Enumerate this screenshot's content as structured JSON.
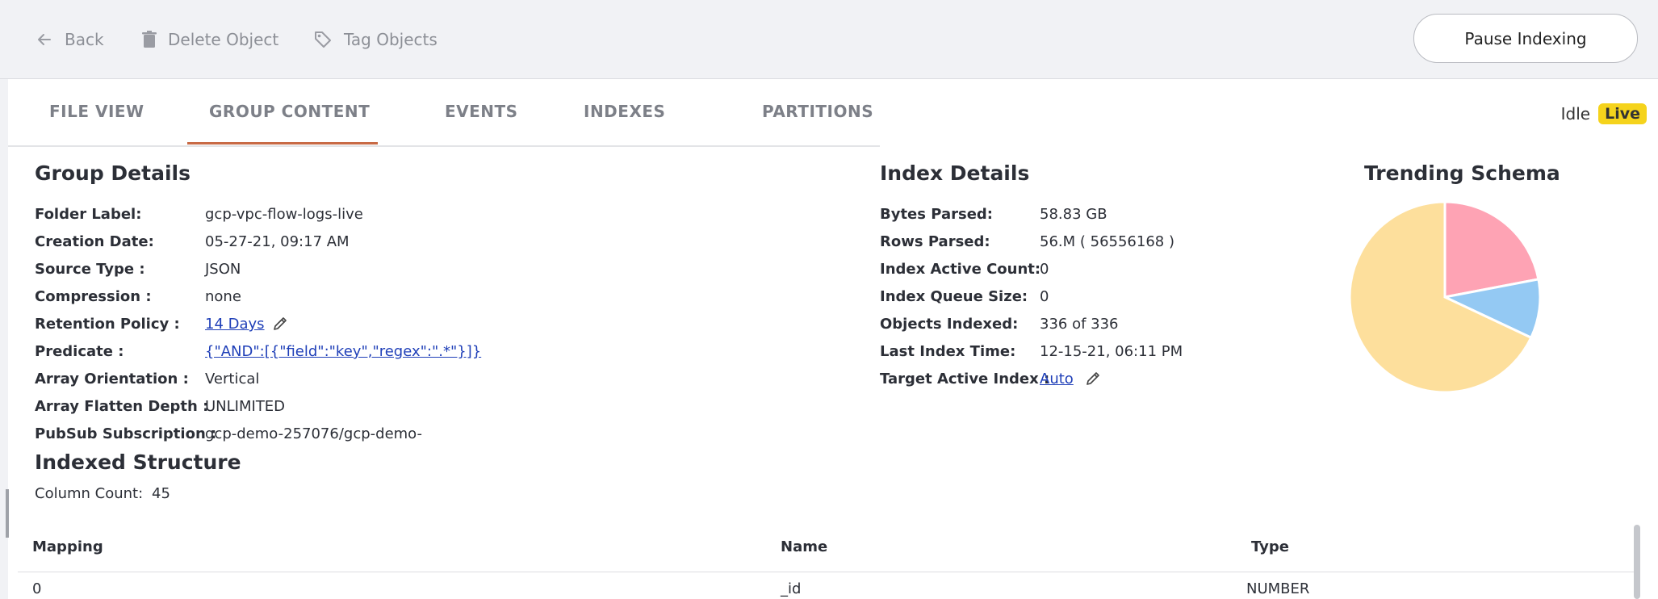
{
  "toolbar": {
    "back_label": "Back",
    "delete_label": "Delete Object",
    "tag_label": "Tag Objects",
    "pause_label": "Pause Indexing"
  },
  "tabs": [
    {
      "label": "FILE VIEW"
    },
    {
      "label": "GROUP CONTENT",
      "active": true
    },
    {
      "label": "EVENTS"
    },
    {
      "label": "INDEXES"
    },
    {
      "label": "PARTITIONS"
    }
  ],
  "status": {
    "state": "Idle",
    "badge": "Live",
    "badge_color": "#f5d31c"
  },
  "group_details": {
    "title": "Group Details",
    "rows": [
      {
        "label": "Folder Label:",
        "value": "gcp-vpc-flow-logs-live"
      },
      {
        "label": "Creation Date:",
        "value": "05-27-21, 09:17 AM"
      },
      {
        "label": "Source Type :",
        "value": "JSON"
      },
      {
        "label": "Compression :",
        "value": "none"
      },
      {
        "label": "Retention Policy :",
        "value": "14 Days"
      },
      {
        "label": "Predicate :",
        "value": "{\"AND\":[{\"field\":\"key\",\"regex\":\".*\"}]}"
      },
      {
        "label": "Array Orientation :",
        "value": "Vertical"
      },
      {
        "label": "Array Flatten Depth :",
        "value": "UNLIMITED"
      },
      {
        "label": "PubSub Subscription :",
        "value": "gcp-demo-257076/gcp-demo-"
      }
    ]
  },
  "index_details": {
    "title": "Index Details",
    "rows": [
      {
        "label": "Bytes Parsed:",
        "value": "58.83 GB"
      },
      {
        "label": "Rows Parsed:",
        "value": "56.M ( 56556168 )"
      },
      {
        "label": "Index Active Count:",
        "value": "0"
      },
      {
        "label": "Index Queue Size:",
        "value": "0"
      },
      {
        "label": "Objects Indexed:",
        "value": "336 of 336"
      },
      {
        "label": "Last Index Time:",
        "value": "12-15-21, 06:11 PM"
      },
      {
        "label": "Target Active Index :",
        "value": "Auto"
      }
    ]
  },
  "trending_schema": {
    "title": "Trending Schema"
  },
  "chart_data": {
    "type": "pie",
    "title": "Trending Schema",
    "slices": [
      {
        "value": 0.22,
        "color": "#fea3b4"
      },
      {
        "value": 0.1,
        "color": "#94c9f3"
      },
      {
        "value": 0.68,
        "color": "#fddf9c"
      }
    ]
  },
  "indexed_structure": {
    "title": "Indexed Structure",
    "column_count_label": "Column Count:",
    "column_count": "45"
  },
  "table": {
    "headers": [
      "Mapping",
      "Name",
      "Type"
    ],
    "rows": [
      [
        "0",
        "_id",
        "NUMBER"
      ]
    ]
  }
}
